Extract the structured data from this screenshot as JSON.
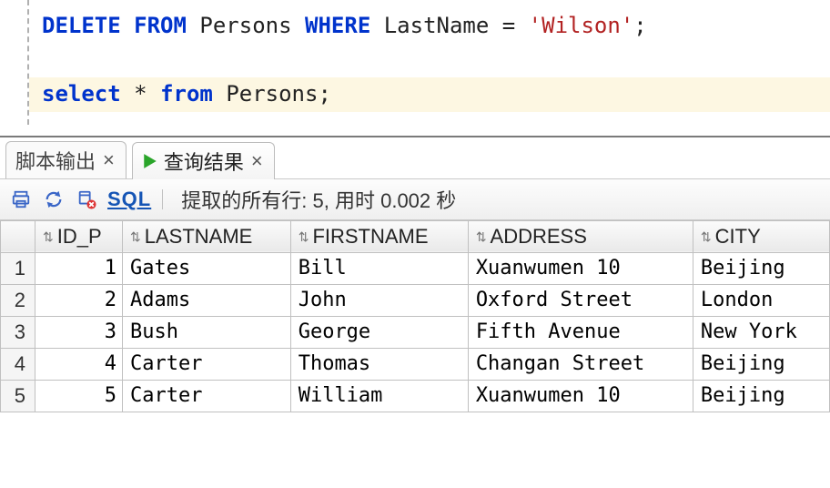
{
  "editor": {
    "line1": {
      "kw1": "DELETE",
      "kw2": "FROM",
      "tbl": "Persons",
      "kw3": "WHERE",
      "col": "LastName",
      "eq": "=",
      "val": "'Wilson'",
      "semi": ";"
    },
    "line2": {
      "kw1": "select",
      "star": "*",
      "kw2": "from",
      "tbl": "Persons",
      "semi": ";"
    }
  },
  "tabs": {
    "script_output": {
      "label": "脚本输出"
    },
    "query_result": {
      "label": "查询结果"
    },
    "close": "×"
  },
  "toolbar": {
    "sql_link": "SQL",
    "status_prefix": "提取的所有行:",
    "row_count": "5",
    "status_middle": ", 用时",
    "elapsed": "0.002",
    "status_suffix": "秒"
  },
  "columns": {
    "col1": "ID_P",
    "col2": "LASTNAME",
    "col3": "FIRSTNAME",
    "col4": "ADDRESS",
    "col5": "CITY"
  },
  "rows": {
    "r1": {
      "n": "1",
      "id": "1",
      "lastname": "Gates",
      "firstname": "Bill",
      "address": "Xuanwumen 10",
      "city": "Beijing"
    },
    "r2": {
      "n": "2",
      "id": "2",
      "lastname": "Adams",
      "firstname": "John",
      "address": "Oxford Street",
      "city": "London"
    },
    "r3": {
      "n": "3",
      "id": "3",
      "lastname": "Bush",
      "firstname": "George",
      "address": "Fifth Avenue",
      "city": "New York"
    },
    "r4": {
      "n": "4",
      "id": "4",
      "lastname": "Carter",
      "firstname": "Thomas",
      "address": "Changan Street",
      "city": "Beijing"
    },
    "r5": {
      "n": "5",
      "id": "5",
      "lastname": "Carter",
      "firstname": "William",
      "address": "Xuanwumen 10",
      "city": "Beijing"
    }
  }
}
